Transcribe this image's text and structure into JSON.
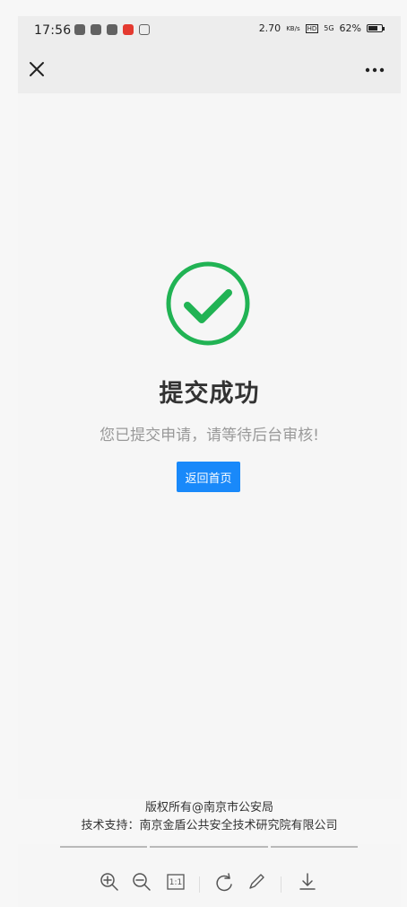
{
  "status_bar": {
    "time": "17:56",
    "network_speed": "2.70",
    "network_unit": "KB/s",
    "hd": "HD",
    "signal": "5G",
    "battery": "62%"
  },
  "page": {
    "title": "提交成功",
    "message": "您已提交申请，请等待后台审核!",
    "home_button": "返回首页"
  },
  "footer": {
    "copyright": "版权所有@南京市公安局",
    "support": "技术支持：南京金盾公共安全技术研究院有限公司"
  },
  "toolbar": {
    "actual_size": "1:1"
  },
  "icons": {
    "success": "check-circle-icon",
    "close": "close-icon",
    "more": "more-icon",
    "zoom_in": "zoom-in-icon",
    "zoom_out": "zoom-out-icon",
    "rotate": "rotate-icon",
    "edit": "edit-icon",
    "download": "download-icon"
  },
  "colors": {
    "success": "#21b354",
    "primary": "#1989fa",
    "title": "#333333",
    "message": "#999999"
  }
}
